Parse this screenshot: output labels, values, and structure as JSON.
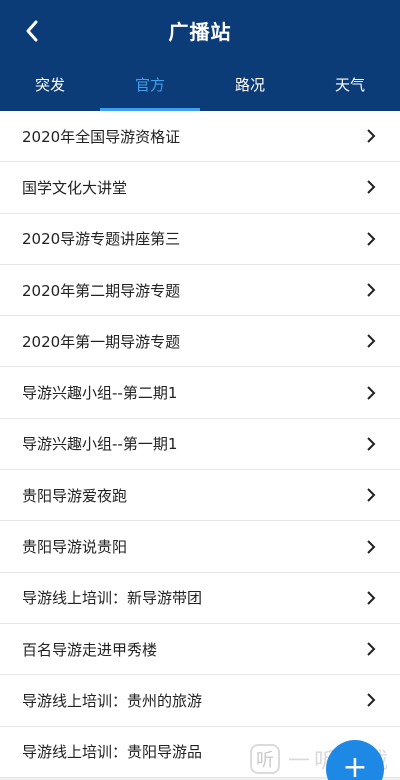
{
  "header": {
    "title": "广播站",
    "back_icon": "chevron-left-icon"
  },
  "tabs": [
    {
      "label": "突发",
      "active": false
    },
    {
      "label": "官方",
      "active": true
    },
    {
      "label": "路况",
      "active": false
    },
    {
      "label": "天气",
      "active": false
    }
  ],
  "list": {
    "items": [
      {
        "label": "2020年全国导游资格证"
      },
      {
        "label": "国学文化大讲堂"
      },
      {
        "label": "2020导游专题讲座第三"
      },
      {
        "label": "2020年第二期导游专题"
      },
      {
        "label": "2020年第一期导游专题"
      },
      {
        "label": "导游兴趣小组--第二期1"
      },
      {
        "label": "导游兴趣小组--第一期1"
      },
      {
        "label": "贵阳导游爱夜跑"
      },
      {
        "label": "贵阳导游说贵阳"
      },
      {
        "label": "导游线上培训：新导游带团"
      },
      {
        "label": "百名导游走进甲秀楼"
      },
      {
        "label": "导游线上培训：贵州的旅游"
      },
      {
        "label": "导游线上培训：贵阳导游品"
      }
    ],
    "chevron_icon": "chevron-right-icon"
  },
  "watermark": {
    "logo_text": "听",
    "text": "一听下载"
  },
  "fab": {
    "label": "+",
    "icon": "plus-icon"
  },
  "colors": {
    "header_bg": "#0c3c78",
    "tab_active": "#3fa0f0",
    "fab_bg": "#1e88e5"
  }
}
